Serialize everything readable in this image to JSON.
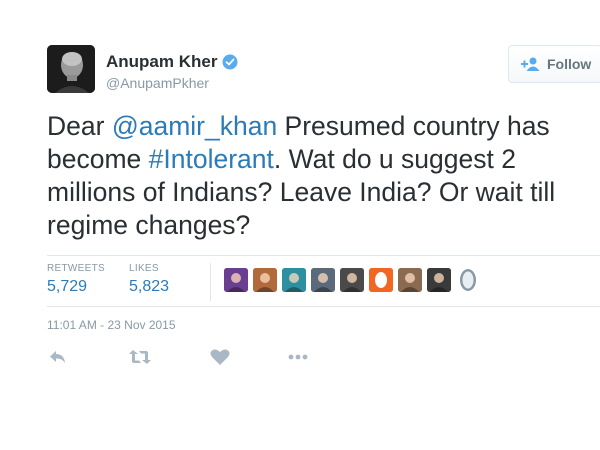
{
  "author": {
    "name": "Anupam Kher",
    "handle": "@AnupamPkher",
    "verified": true
  },
  "follow_button": {
    "label": "Follow"
  },
  "tweet": {
    "segments": [
      {
        "text": "Dear ",
        "link": false
      },
      {
        "text": "@aamir_khan",
        "link": true
      },
      {
        "text": " Presumed country has become ",
        "link": false
      },
      {
        "text": "#Intolerant",
        "link": true
      },
      {
        "text": ". Wat do u suggest 2 millions of Indians? Leave India? Or wait till regime changes?",
        "link": false
      }
    ]
  },
  "stats": {
    "retweets_label": "RETWEETS",
    "retweets_value": "5,729",
    "likes_label": "LIKES",
    "likes_value": "5,823"
  },
  "likers": [
    {
      "color": "#6a3f8f"
    },
    {
      "color": "#b06a3c"
    },
    {
      "color": "#2e8fa0"
    },
    {
      "color": "#5a6a7a"
    },
    {
      "color": "#4a4a4a"
    },
    {
      "color": "#f26522"
    },
    {
      "color": "#8a6a50"
    },
    {
      "color": "#3a3a3a"
    },
    {
      "color": "#8899a6"
    }
  ],
  "timestamp": "11:01 AM - 23 Nov 2015",
  "colors": {
    "link": "#2b7bb9",
    "muted": "#8899a6",
    "verified": "#55acee",
    "icon": "#a9b8c4"
  },
  "actions": [
    "reply-icon",
    "retweet-icon",
    "like-icon",
    "more-icon"
  ]
}
